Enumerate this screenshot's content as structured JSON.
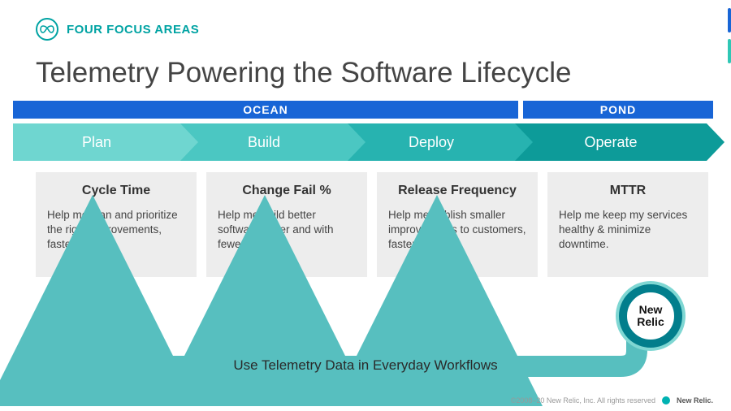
{
  "header": {
    "brand": "FOUR FOCUS AREAS"
  },
  "title": "Telemetry Powering the Software Lifecycle",
  "bars": {
    "ocean": "OCEAN",
    "pond": "POND"
  },
  "chevrons": [
    "Plan",
    "Build",
    "Deploy",
    "Operate"
  ],
  "cards": [
    {
      "title": "Cycle Time",
      "body": "Help me plan and prioritize the right improvements, faster."
    },
    {
      "title": "Change Fail %",
      "body": "Help me build better software faster and with fewer defects."
    },
    {
      "title": "Release Frequency",
      "body": "Help me publish smaller improvements to customers, faster."
    },
    {
      "title": "MTTR",
      "body": "Help me keep my services healthy & minimize downtime."
    }
  ],
  "flow_label": "Use Telemetry Data in Everyday Workflows",
  "badge": "New\nRelic",
  "footer": {
    "copyright": "©2008–20 New Relic, Inc. All rights reserved",
    "brand": "New Relic."
  }
}
